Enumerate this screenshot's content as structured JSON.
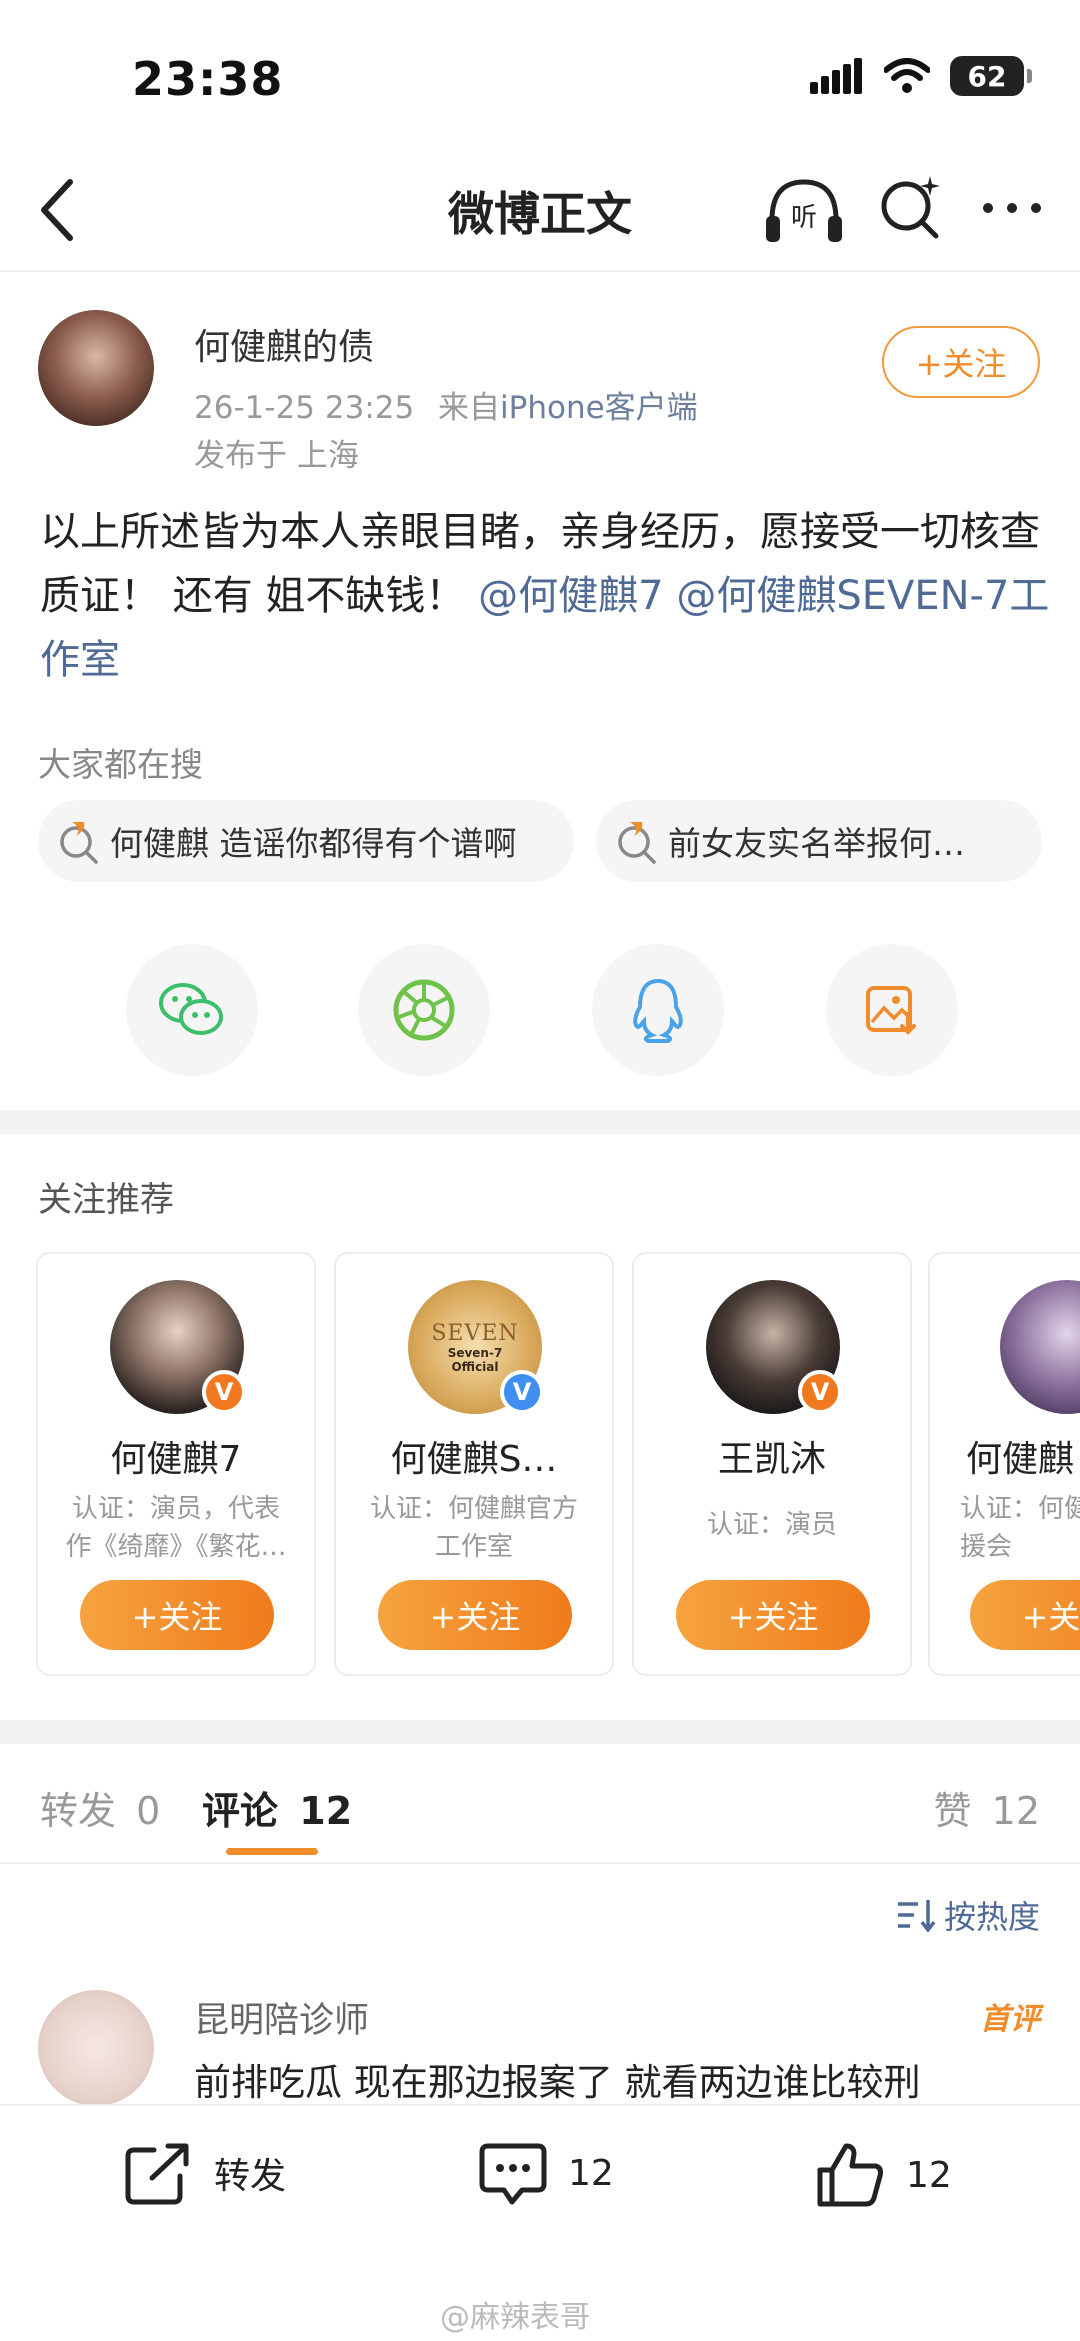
{
  "status": {
    "time": "23:38",
    "battery": "62"
  },
  "nav": {
    "title": "微博正文",
    "listen_label": "听"
  },
  "post": {
    "author": "何健麒的债",
    "timestamp": "26-1-25 23:25",
    "source_prefix": "来自",
    "source": "iPhone客户端",
    "location": "发布于 上海",
    "follow_label": "+关注",
    "text_before": "以上所述皆为本人亲眼目睹，亲身经历，愿接受一切核查质证！ 还有 姐不缺钱！",
    "mention_1": "@何健麒7",
    "mention_2": "@何健麒SEVEN-7工作室"
  },
  "hot_search": {
    "heading": "大家都在搜",
    "items": [
      "何健麒 造谣你都得有个谱啊",
      "前女友实名举报何…"
    ]
  },
  "share": {
    "icons": [
      "wechat-icon",
      "moments-icon",
      "qq-icon",
      "save-image-icon"
    ]
  },
  "recommend": {
    "heading": "关注推荐",
    "cards": [
      {
        "name": "何健麒7",
        "desc": "认证：演员，代表作《绮靡》《繁花…",
        "badge": "V",
        "badge_color": "#f0781e",
        "button": "+关注"
      },
      {
        "name": "何健麒S…",
        "desc": "认证：何健麒官方工作室",
        "badge": "V",
        "badge_color": "#3e8ff0",
        "button": "+关注",
        "avatar_text_1": "SEVEN",
        "avatar_text_2": "Seven-7 Official"
      },
      {
        "name": "王凯沐",
        "desc": "认证：演员",
        "badge": "V",
        "badge_color": "#f0781e",
        "button": "+关注"
      },
      {
        "name": "何健麒",
        "desc": "认证：何健麒粉丝后援会",
        "badge": "",
        "badge_color": "",
        "button": "+关注"
      }
    ]
  },
  "tabs": {
    "repost_label": "转发",
    "repost_count": "0",
    "comment_label": "评论",
    "comment_count": "12",
    "like_label": "赞",
    "like_count": "12"
  },
  "sort_label": "按热度",
  "comment": {
    "name": "昆明陪诊师",
    "badge": "首评",
    "text": "前排吃瓜 现在那边报案了 就看两边谁比较刑"
  },
  "bottom": {
    "repost": "转发",
    "comments": "12",
    "likes": "12"
  },
  "watermark": "@麻辣表哥",
  "colors": {
    "accent": "#f08c2b",
    "link": "#4f6a95"
  }
}
